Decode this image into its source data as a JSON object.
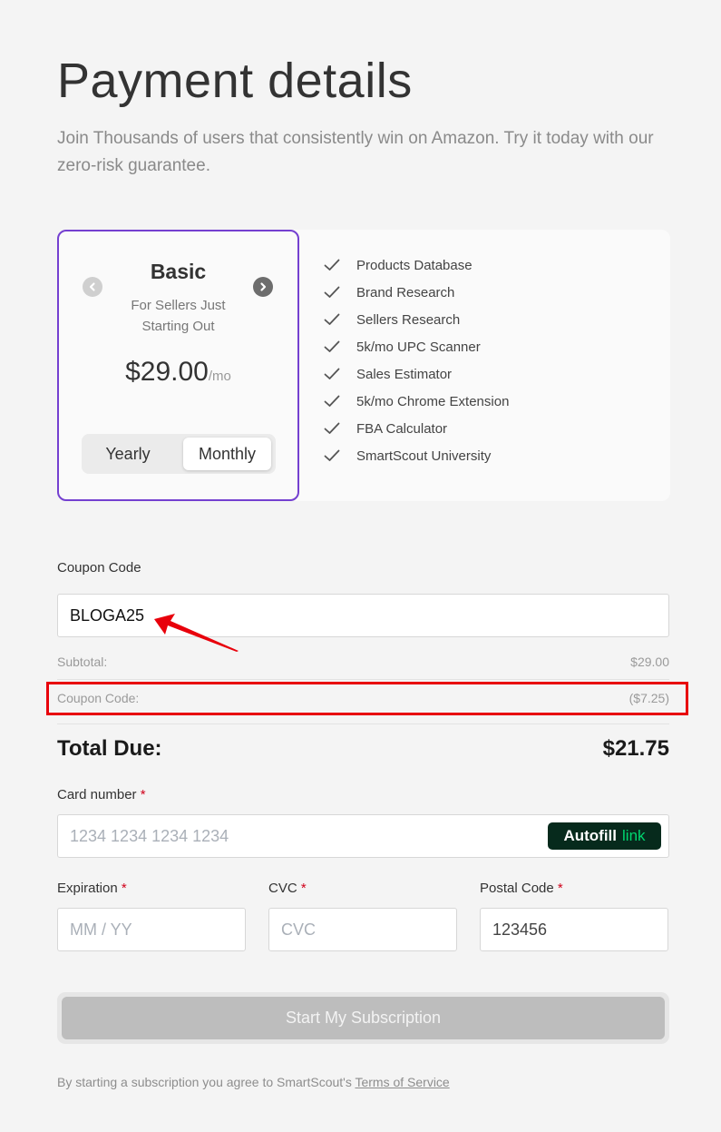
{
  "header": {
    "title": "Payment details",
    "subtitle": "Join Thousands of users that consistently win on Amazon. Try it today with our zero-risk guarantee."
  },
  "plan": {
    "name": "Basic",
    "description": "For Sellers Just Starting Out",
    "price": "$29.00",
    "period": "/mo",
    "billing_options": [
      "Yearly",
      "Monthly"
    ],
    "selected_billing": "Monthly",
    "prev_icon": "chevron-left-icon",
    "next_icon": "chevron-right-icon",
    "accent_color": "#7440d0"
  },
  "features": [
    "Products Database",
    "Brand Research",
    "Sellers Research",
    "5k/mo UPC Scanner",
    "Sales Estimator",
    "5k/mo Chrome Extension",
    "FBA Calculator",
    "SmartScout University"
  ],
  "coupon": {
    "label": "Coupon Code",
    "value": "BLOGA25"
  },
  "summary": {
    "subtotal_label": "Subtotal:",
    "subtotal_value": "$29.00",
    "coupon_label": "Coupon Code:",
    "coupon_value": "($7.25)",
    "total_label": "Total Due:",
    "total_value": "$21.75",
    "highlight_color": "#e8000b"
  },
  "card": {
    "number_label": "Card number",
    "number_placeholder": "1234 1234 1234 1234",
    "autofill_label": "Autofill",
    "autofill_link": "link",
    "expiration_label": "Expiration",
    "expiration_placeholder": "MM / YY",
    "cvc_label": "CVC",
    "cvc_placeholder": "CVC",
    "postal_label": "Postal Code",
    "postal_value": "123456",
    "required_mark": "*"
  },
  "submit": {
    "label": "Start My Subscription"
  },
  "terms": {
    "text": "By starting a subscription you agree to SmartScout's ",
    "link": "Terms of Service"
  }
}
